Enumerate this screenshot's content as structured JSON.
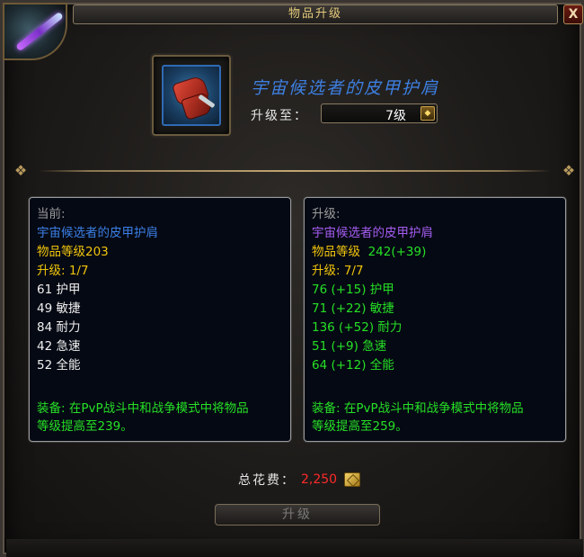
{
  "window": {
    "title": "物品升级",
    "close_label": "X"
  },
  "item": {
    "name": "宇宙候选者的皮甲护肩",
    "upgrade_to_label": "升级至：",
    "upgrade_level_value": "7级"
  },
  "current": {
    "header": "当前:",
    "name": "宇宙候选者的皮甲护肩",
    "item_level": "物品等级203",
    "upgrade": "升级:  1/7",
    "stats": [
      "61 护甲",
      "49 敏捷",
      "84 耐力",
      "42 急速",
      "52 全能"
    ],
    "equip_line1": "装备: 在PvP战斗中和战争模式中将物品",
    "equip_line2": "等级提高至239。"
  },
  "upgraded": {
    "header": "升级:",
    "name": "宇宙候选者的皮甲护肩",
    "item_level": "物品等级  242(+39)",
    "upgrade": "升级:  7/7",
    "stats": [
      "76 (+15) 护甲",
      "71 (+22) 敏捷",
      "136 (+52) 耐力",
      "51 (+9) 急速",
      "64 (+12) 全能"
    ],
    "equip_line1": "装备: 在PvP战斗中和战争模式中将物品",
    "equip_line2": "等级提高至259。"
  },
  "footer": {
    "cost_label": "总花费：",
    "cost_value": "2,250",
    "upgrade_button": "升级"
  },
  "colors": {
    "title_gold": "#e3c97a",
    "name_blue": "#3c7fe6",
    "epic_purple": "#a55cf0",
    "stat_green": "#26e026",
    "level_gold": "#f0c40c",
    "cost_red": "#ff2a2a"
  },
  "icons": [
    "character-portrait-icon",
    "shoulder-armor-icon",
    "dropdown-arrow-icon",
    "gold-coin-icon",
    "close-icon"
  ]
}
